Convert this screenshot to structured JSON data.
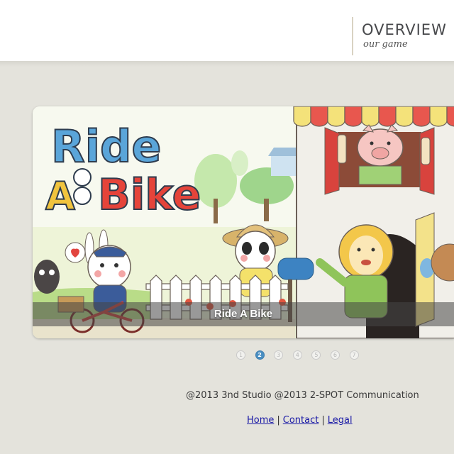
{
  "header": {
    "nav_title": "OVERVIEW",
    "nav_subtitle": "our game"
  },
  "slider": {
    "logo_word_1": "Ride",
    "logo_word_2": "A",
    "logo_word_3": "Bike",
    "caption": "Ride A Bike",
    "active_slide": 2,
    "pager": [
      "1",
      "2",
      "3",
      "4",
      "5",
      "6",
      "7"
    ]
  },
  "footer": {
    "copyright": "@2013 3nd Studio @2013 2-SPOT Communication",
    "links": {
      "home": "Home",
      "contact": "Contact",
      "legal": "Legal",
      "separator": "|"
    }
  },
  "colors": {
    "page_background": "#e4e3dc",
    "pager_active": "#4a8fc2",
    "link": "#1a1aa6"
  }
}
